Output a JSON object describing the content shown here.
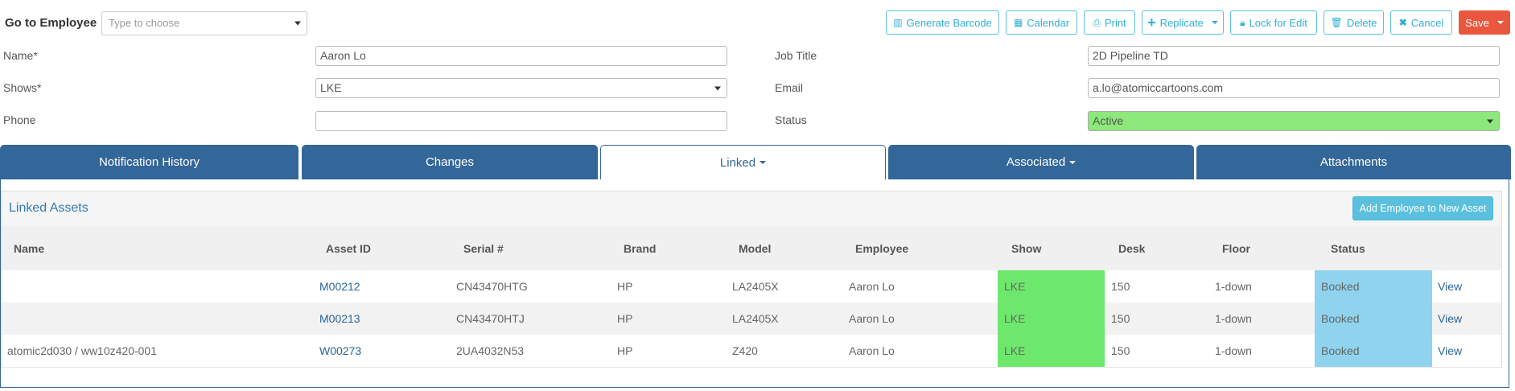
{
  "goto": {
    "label": "Go to Employee",
    "placeholder": "Type to choose"
  },
  "toolbar": [
    {
      "label": "Generate Barcode",
      "icon": "barcode-icon"
    },
    {
      "label": "Calendar",
      "icon": "calendar-icon"
    },
    {
      "label": "Print",
      "icon": "print-icon"
    },
    {
      "label": "Replicate",
      "icon": "plus-icon"
    },
    {
      "label": "Lock for Edit",
      "icon": "lock-icon"
    },
    {
      "label": "Delete",
      "icon": "trash-icon"
    },
    {
      "label": "Cancel",
      "icon": "close-icon"
    },
    {
      "label": "Save",
      "icon": "chevron-down-icon"
    }
  ],
  "form": {
    "name_label": "Name*",
    "name_value": "Aaron Lo",
    "shows_label": "Shows*",
    "shows_value": "LKE",
    "phone_label": "Phone",
    "phone_value": "",
    "job_title_label": "Job Title",
    "job_title_value": "2D Pipeline TD",
    "email_label": "Email",
    "email_value": "a.lo@atomiccartoons.com",
    "status_label": "Status",
    "status_value": "Active"
  },
  "tabs": [
    {
      "label": "Notification History"
    },
    {
      "label": "Changes"
    },
    {
      "label": "Linked"
    },
    {
      "label": "Associated"
    },
    {
      "label": "Attachments"
    }
  ],
  "panel": {
    "title": "Linked Assets",
    "add_button": "Add Employee to New Asset",
    "columns": [
      "Name",
      "Asset ID",
      "Serial #",
      "Brand",
      "Model",
      "Employee",
      "Show",
      "Desk",
      "Floor",
      "Status"
    ],
    "rows": [
      {
        "name": "",
        "asset_id": "M00212",
        "serial": "CN43470HTG",
        "brand": "HP",
        "model": "LA2405X",
        "employee": "Aaron Lo",
        "show": "LKE",
        "desk": "150",
        "floor": "1-down",
        "status": "Booked",
        "action": "View"
      },
      {
        "name": "",
        "asset_id": "M00213",
        "serial": "CN43470HTJ",
        "brand": "HP",
        "model": "LA2405X",
        "employee": "Aaron Lo",
        "show": "LKE",
        "desk": "150",
        "floor": "1-down",
        "status": "Booked",
        "action": "View"
      },
      {
        "name": "atomic2d030 / ww10z420-001",
        "asset_id": "W00273",
        "serial": "2UA4032N53",
        "brand": "HP",
        "model": "Z420",
        "employee": "Aaron Lo",
        "show": "LKE",
        "desk": "150",
        "floor": "1-down",
        "status": "Booked",
        "action": "View"
      }
    ]
  },
  "colors": {
    "tab": "#336699",
    "save": "#e9573f",
    "show_green": "#6de86d",
    "status_blue": "#8fd3ee",
    "active_green": "#8de87b"
  }
}
